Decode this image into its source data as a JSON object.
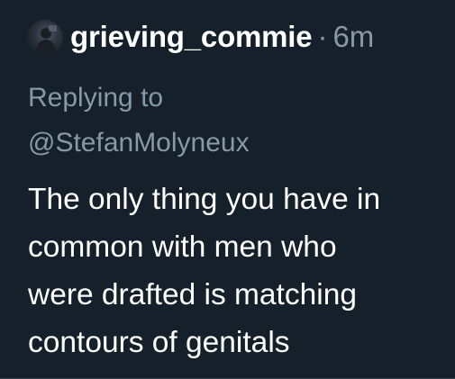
{
  "tweet": {
    "username": "grieving_commie",
    "separator": "·",
    "time": "6m",
    "replying_label": "Replying to",
    "replying_to": "@StefanMolyneux",
    "body_lines": [
      "The only thing you have in",
      "common with men who",
      "were drafted is matching",
      "contours of genitals"
    ]
  },
  "icons": {
    "avatar": "avatar-photo"
  },
  "colors": {
    "background": "#15202b",
    "primary_text": "#ffffff",
    "secondary_text": "#8899a6"
  }
}
